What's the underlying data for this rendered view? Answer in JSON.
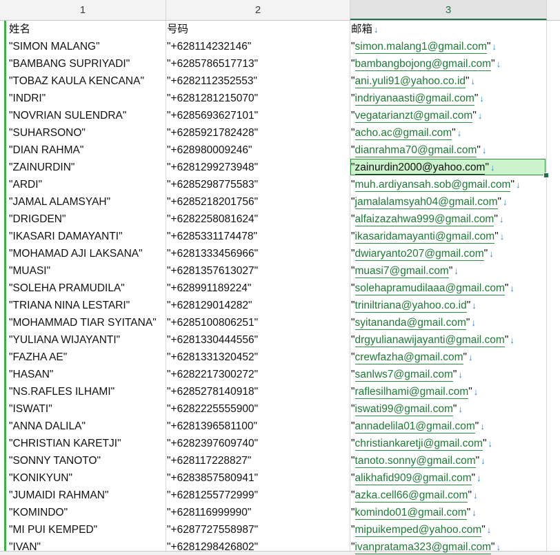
{
  "columns": [
    "1",
    "2",
    "3"
  ],
  "header": {
    "name": "姓名",
    "phone": "号码",
    "email": "邮箱"
  },
  "rows": [
    {
      "name": "SIMON MALANG",
      "phone": "+628114232146",
      "email": "simon.malang1@gmail.com"
    },
    {
      "name": "BAMBANG SUPRIYADI",
      "phone": "+6285786517713",
      "email": "bambangbojong@gmail.com"
    },
    {
      "name": "TOBAZ KAULA KENCANA",
      "phone": "+6282112352553",
      "email": "ani.yuli91@yahoo.co.id"
    },
    {
      "name": "INDRI",
      "phone": "+6281281215070",
      "email": "indriyanaasti@gmail.com"
    },
    {
      "name": "NOVRIAN SULENDRA",
      "phone": "+6285693627101",
      "email": "vegatarianzt@gmail.com"
    },
    {
      "name": "SUHARSONO",
      "phone": "+6285921782428",
      "email": "acho.ac@gmail.com"
    },
    {
      "name": "DIAN RAHMA",
      "phone": "+628980009246",
      "email": "dianrahma70@gmail.com"
    },
    {
      "name": "ZAINURDIN",
      "phone": "+6281299273948",
      "email": "zainurdin2000@yahoo.com"
    },
    {
      "name": "ARDI",
      "phone": "+6285298775583",
      "email": "muh.ardiyansah.sob@gmail.com"
    },
    {
      "name": "JAMAL ALAMSYAH",
      "phone": "+6285218201756",
      "email": "jamalalamsyah04@gmail.com"
    },
    {
      "name": "DRIGDEN",
      "phone": "+6282258081624",
      "email": "alfaizazahwa999@gmail.com"
    },
    {
      "name": "IKASARI DAMAYANTI",
      "phone": "+6285331174478",
      "email": "ikasaridamayanti@gmail.com"
    },
    {
      "name": "MOHAMAD AJI LAKSANA",
      "phone": "+6281333456966",
      "email": "dwiaryanto207@gmail.com"
    },
    {
      "name": "MUASI",
      "phone": "+6281357613027",
      "email": "muasi7@gmail.com"
    },
    {
      "name": "SOLEHA PRAMUDILA",
      "phone": "+628991189224",
      "email": "solehapramudilaaa@gmail.com"
    },
    {
      "name": "TRIANA NINA LESTARI",
      "phone": "+628129014282",
      "email": "triniltriana@yahoo.co.id"
    },
    {
      "name": "MOHAMMAD TIAR SYITANA",
      "phone": "+6285100806251",
      "email": "syitananda@gmail.com"
    },
    {
      "name": "YULIANA WIJAYANTI",
      "phone": "+6281330444556",
      "email": "drgyulianawijayanti@gmail.com"
    },
    {
      "name": "FAZHA AE",
      "phone": "+6281331320452",
      "email": "crewfazha@gmail.com"
    },
    {
      "name": "HASAN",
      "phone": "+6282217300272",
      "email": "sanlws7@gmail.com"
    },
    {
      "name": "NS.RAFLES ILHAMI",
      "phone": "+6285278140918",
      "email": "raflesilhami@gmail.com"
    },
    {
      "name": "ISWATI",
      "phone": "+6282225555900",
      "email": "iswati99@gmail.com"
    },
    {
      "name": "ANNA DALILA",
      "phone": "+6281396581100",
      "email": "annadelila01@gmail.com"
    },
    {
      "name": "CHRISTIAN KARETJI",
      "phone": "+6282397609740",
      "email": "christiankaretji@gmail.com"
    },
    {
      "name": "SONNY TANOTO",
      "phone": "+628117228827",
      "email": "tanoto.sonny@gmail.com"
    },
    {
      "name": "KONIKYUN",
      "phone": "+6283857580941",
      "email": "alikhafid909@gmail.com"
    },
    {
      "name": "JUMAIDI RAHMAN",
      "phone": "+6281255772999",
      "email": "azka.cell66@gmail.com"
    },
    {
      "name": "KOMINDO",
      "phone": "+628116999990",
      "email": "komindo01@gmail.com"
    },
    {
      "name": "MI PUI KEMPED",
      "phone": "+6287727558987",
      "email": "mipuikemped@yahoo.com"
    },
    {
      "name": "IVAN",
      "phone": "+6281298426802",
      "email": "ivanpratama323@gmail.com"
    }
  ],
  "selected_row_index": 7,
  "arrow_glyph": "↓",
  "quote": "\"",
  "colors": {
    "accent": "#217346",
    "email_text": "#1e7a35",
    "arrow": "#2f7fd6",
    "selection_fill": "#cdf3cd"
  }
}
